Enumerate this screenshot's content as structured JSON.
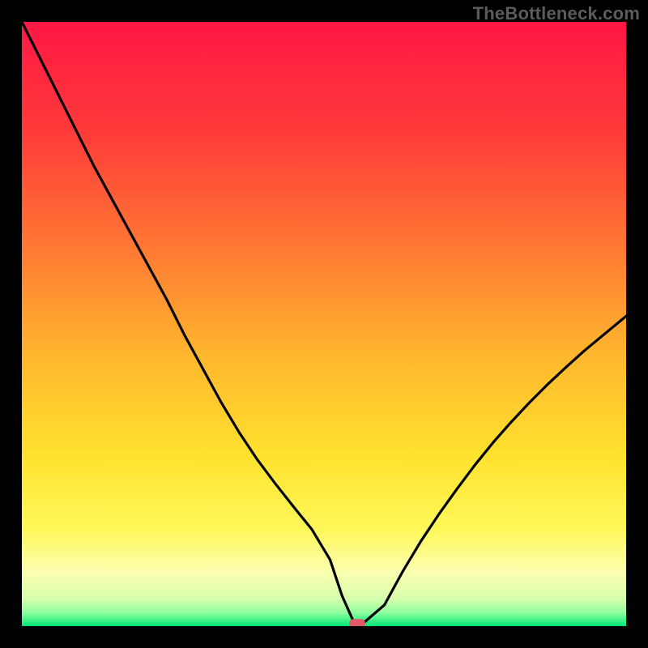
{
  "watermark": "TheBottleneck.com",
  "chart_data": {
    "type": "line",
    "title": "",
    "xlabel": "",
    "ylabel": "",
    "xlim": [
      0,
      100
    ],
    "ylim": [
      0,
      100
    ],
    "grid": false,
    "legend": false,
    "x": [
      0,
      3,
      6,
      9,
      12,
      15,
      18,
      21,
      24,
      27,
      30,
      33,
      36,
      39,
      42,
      45,
      48,
      51,
      53,
      55,
      56.5,
      60,
      63,
      66,
      69,
      72,
      75,
      78,
      81,
      84,
      87,
      90,
      93,
      96,
      100
    ],
    "values": [
      100,
      94,
      88,
      82,
      76,
      70.5,
      65,
      59.5,
      54,
      48,
      42.5,
      37,
      32,
      27.5,
      23.5,
      19.7,
      16,
      11,
      5,
      0.5,
      0.5,
      3.5,
      9,
      14,
      18.5,
      22.7,
      26.7,
      30.4,
      33.8,
      37,
      40,
      42.8,
      45.5,
      48,
      51.3
    ],
    "gradient_stops": [
      {
        "offset": 0.0,
        "color": "#ff1744"
      },
      {
        "offset": 0.18,
        "color": "#ff3a3a"
      },
      {
        "offset": 0.38,
        "color": "#ff7a33"
      },
      {
        "offset": 0.55,
        "color": "#ffb62e"
      },
      {
        "offset": 0.72,
        "color": "#ffe22e"
      },
      {
        "offset": 0.84,
        "color": "#fff85a"
      },
      {
        "offset": 0.91,
        "color": "#fbffb0"
      },
      {
        "offset": 0.955,
        "color": "#d6ffad"
      },
      {
        "offset": 0.978,
        "color": "#8eff9e"
      },
      {
        "offset": 1.0,
        "color": "#00e676"
      }
    ],
    "marker": {
      "x": 55.5,
      "y": 0.5,
      "color": "#e05a6a"
    }
  }
}
